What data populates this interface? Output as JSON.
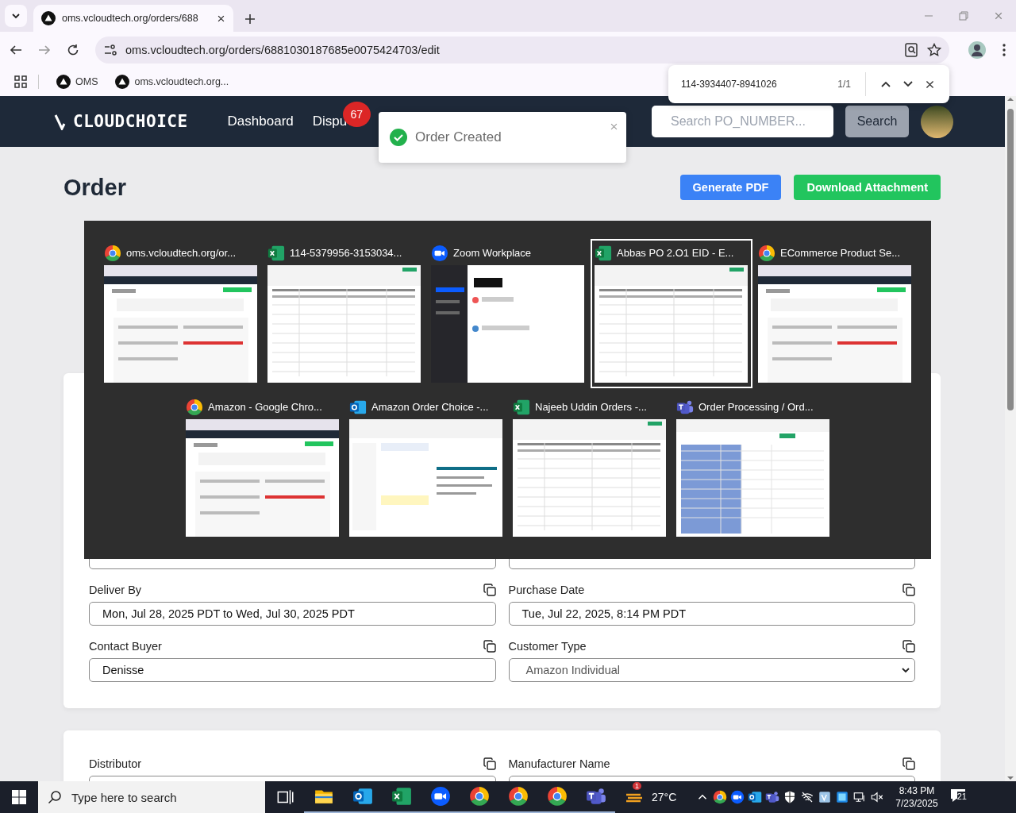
{
  "browser": {
    "tab_title": "oms.vcloudtech.org/orders/688",
    "url": "oms.vcloudtech.org/orders/6881030187685e0075424703/edit",
    "bookmarks": [
      "OMS",
      "oms.vcloudtech.org..."
    ]
  },
  "find_bar": {
    "query": "114-3934407-8941026",
    "count": "1/1"
  },
  "header": {
    "logo": "CLOUDCHOICE",
    "nav": [
      {
        "label": "Dashboard"
      },
      {
        "label": "Dispu",
        "badge": "67"
      }
    ],
    "search": {
      "placeholder": "Search PO_NUMBER..."
    },
    "search_button": "Search"
  },
  "toast": {
    "message": "Order Created"
  },
  "page": {
    "title": "Order",
    "buttons": [
      {
        "label": "Generate PDF",
        "kind": "primary"
      },
      {
        "label": "Download Attachment",
        "kind": "success"
      }
    ]
  },
  "order_card": {
    "rows": [
      [
        {
          "kind": "text"
        },
        {
          "kind": "text"
        }
      ],
      [
        {
          "label": "Deliver By",
          "value": "Mon, Jul 28, 2025 PDT to Wed, Jul 30, 2025 PDT",
          "kind": "text"
        },
        {
          "label": "Purchase Date",
          "value": "Tue, Jul 22, 2025, 8:14 PM PDT",
          "kind": "text"
        }
      ],
      [
        {
          "label": "Contact Buyer",
          "value": "Denisse",
          "kind": "text"
        },
        {
          "label": "Customer Type",
          "value": "Amazon Individual",
          "kind": "select"
        }
      ]
    ]
  },
  "distributor_card": {
    "fields": [
      {
        "label": "Distributor"
      },
      {
        "label": "Manufacturer Name"
      }
    ]
  },
  "task_switcher": {
    "windows": [
      {
        "title": "oms.vcloudtech.org/or...",
        "kind": "chrome",
        "selected": false
      },
      {
        "title": "114-5379956-3153034...",
        "kind": "excel",
        "selected": false
      },
      {
        "title": "Zoom Workplace",
        "kind": "zoom",
        "selected": false
      },
      {
        "title": "Abbas PO 2.O1  EID - E...",
        "kind": "excel",
        "selected": true
      },
      {
        "title": "ECommerce Product Se...",
        "kind": "chrome",
        "selected": false
      },
      {
        "title": "Amazon - Google Chro...",
        "kind": "chrome",
        "selected": false
      },
      {
        "title": "Amazon Order Choice -...",
        "kind": "outlook",
        "selected": false
      },
      {
        "title": "Najeeb Uddin Orders -...",
        "kind": "excel",
        "selected": false
      },
      {
        "title": "Order Processing / Ord...",
        "kind": "teams",
        "selected": false
      }
    ]
  },
  "taskbar": {
    "search": {
      "placeholder": "Type here to search"
    },
    "apps": [
      {
        "kind": "taskview"
      },
      {
        "kind": "explorer"
      },
      {
        "kind": "outlook"
      },
      {
        "kind": "excel"
      },
      {
        "kind": "zoom"
      },
      {
        "kind": "chrome"
      },
      {
        "kind": "chrome"
      },
      {
        "kind": "chrome"
      },
      {
        "kind": "teams"
      }
    ],
    "weather": {
      "temperature": "27°C",
      "badge": "1"
    },
    "tray": [
      {
        "kind": "chevron"
      },
      {
        "kind": "chrome"
      },
      {
        "kind": "zoom"
      },
      {
        "kind": "outlook"
      },
      {
        "kind": "teams"
      },
      {
        "kind": "shield"
      },
      {
        "kind": "network"
      },
      {
        "kind": "vpn"
      },
      {
        "kind": "app"
      },
      {
        "kind": "monitor"
      },
      {
        "kind": "volume"
      }
    ],
    "clock": {
      "time": "8:43 PM",
      "date": "7/23/2025"
    },
    "notifications": "21"
  }
}
